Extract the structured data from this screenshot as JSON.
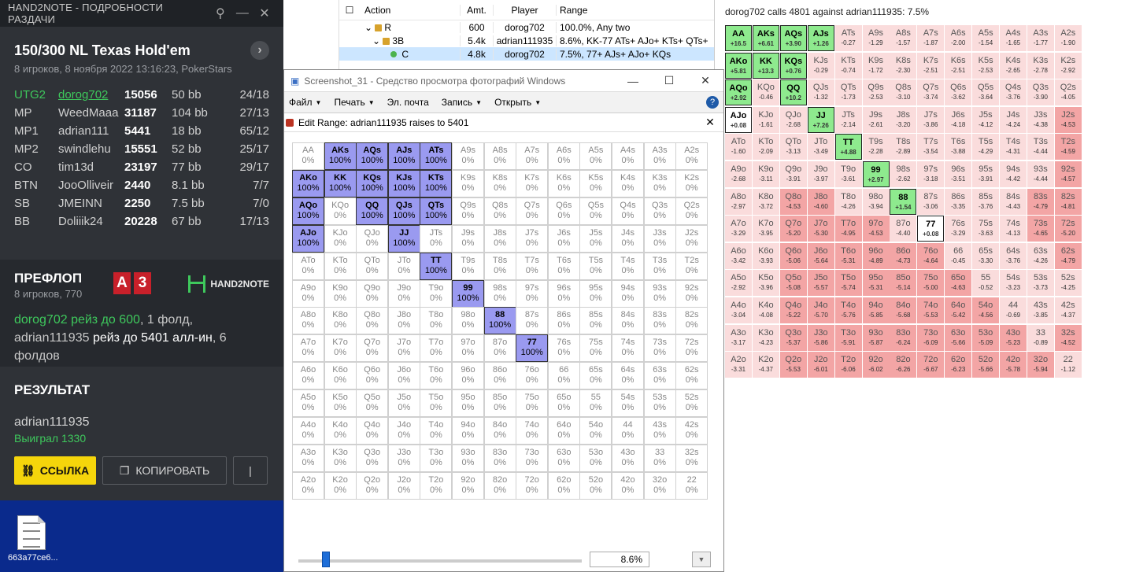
{
  "desktop": {
    "file_label": "663a77ce6..."
  },
  "h2n": {
    "window_title": "HAND2NOTE - ПОДРОБНОСТИ РАЗДАЧИ",
    "game_title": "150/300 NL Texas Hold'em",
    "game_subtitle": "8 игроков, 8 ноября 2022 13:16:23, PokerStars",
    "players": [
      {
        "pos": "UTG2",
        "name": "dorog702",
        "stack": "15056",
        "bb": "50 bb",
        "stat": "24/18"
      },
      {
        "pos": "MP",
        "name": "WeedMaaa",
        "stack": "31187",
        "bb": "104 bb",
        "stat": "27/13"
      },
      {
        "pos": "MP1",
        "name": "adrian111",
        "stack": "5441",
        "bb": "18 bb",
        "stat": "65/12"
      },
      {
        "pos": "MP2",
        "name": "swindlehu",
        "stack": "15551",
        "bb": "52 bb",
        "stat": "25/17"
      },
      {
        "pos": "CO",
        "name": "tim13d",
        "stack": "23197",
        "bb": "77 bb",
        "stat": "29/17"
      },
      {
        "pos": "BTN",
        "name": "JooOlliveir",
        "stack": "2440",
        "bb": "8.1 bb",
        "stat": "7/7"
      },
      {
        "pos": "SB",
        "name": "JMEINN",
        "stack": "2250",
        "bb": "7.5 bb",
        "stat": "7/0"
      },
      {
        "pos": "BB",
        "name": "Doliiik24",
        "stack": "20228",
        "bb": "67 bb",
        "stat": "17/13"
      }
    ],
    "preflop_title": "ПРЕФЛОП",
    "preflop_sub": "8 игроков, 770",
    "cards": [
      "A",
      "3"
    ],
    "logo_text": "HAND2NOTE",
    "action_p1": "dorog702 рейз до 600",
    "action_p2": ", 1 фолд,",
    "action_p3": "adrian111935",
    "action_p4": " рейз до 5401 алл-ин",
    "action_p5": ", 6 фолдов",
    "result_title": "РЕЗУЛЬТАТ",
    "result_name": "adrian111935",
    "result_win": "Выиграл 1330",
    "btn_link": "ССЫЛКА",
    "btn_copy": "КОПИРОВАТЬ"
  },
  "tree": {
    "headers": [
      "Action",
      "Amt.",
      "Player",
      "Range"
    ],
    "rows": [
      {
        "action": "R",
        "amt": "600",
        "player": "dorog702",
        "range": "100.0%, Any two"
      },
      {
        "action": "3B",
        "amt": "5.4k",
        "player": "adrian111935",
        "range": "8.6%, KK-77 ATs+ AJo+ KTs+ QTs+"
      },
      {
        "action": "C",
        "amt": "4.8k",
        "player": "dorog702",
        "range": "7.5%, 77+ AJs+ AJo+ KQs"
      }
    ]
  },
  "viewer": {
    "title": "Screenshot_31 - Средство просмотра фотографий Windows",
    "menu": [
      "Файл",
      "Печать",
      "Эл. почта",
      "Запись",
      "Открыть"
    ],
    "edit_range_title": "Edit Range: adrian111935 raises to 5401",
    "percent": "8.6%",
    "selected": [
      "AKs",
      "AQs",
      "AJs",
      "ATs",
      "AKo",
      "KK",
      "KQs",
      "KJs",
      "KTs",
      "AQo",
      "QQ",
      "QJs",
      "QTs",
      "AJo",
      "JJ",
      "TT",
      "99",
      "88",
      "77"
    ]
  },
  "matrix": {
    "title": "dorog702 calls 4801 against adrian111935: 7.5%",
    "green": [
      "AA",
      "AKs",
      "AQs",
      "AJs",
      "AKo",
      "KK",
      "KQs",
      "AQo",
      "QQ",
      "JJ",
      "TT",
      "99",
      "88"
    ],
    "white": [
      "AJo",
      "77"
    ],
    "colors": {
      "green": "#8eea8e",
      "red_strong": "#f3a5a5",
      "red_light": "#fadcdc"
    },
    "values": [
      [
        "+16.5",
        "+6.61",
        "+3.90",
        "+1.26",
        "-0.27",
        "-1.29",
        "-1.57",
        "-1.87",
        "-2.00",
        "-1.54",
        "-1.65",
        "-1.77",
        "-1.90"
      ],
      [
        "+5.81",
        "+13.3",
        "+0.76",
        "-0.29",
        "-0.74",
        "-1.72",
        "-2.30",
        "-2.51",
        "-2.51",
        "-2.53",
        "-2.65",
        "-2.78",
        "-2.92"
      ],
      [
        "+2.92",
        "-0.46",
        "+10.2",
        "-1.32",
        "-1.73",
        "-2.53",
        "-3.10",
        "-3.74",
        "-3.62",
        "-3.64",
        "-3.76",
        "-3.90",
        "-4.05"
      ],
      [
        "+0.08",
        "-1.61",
        "-2.68",
        "+7.26",
        "-2.14",
        "-2.61",
        "-3.20",
        "-3.86",
        "-4.18",
        "-4.12",
        "-4.24",
        "-4.38",
        "-4.53"
      ],
      [
        "-1.60",
        "-2.09",
        "-3.13",
        "-3.49",
        "+4.88",
        "-2.28",
        "-2.89",
        "-3.54",
        "-3.88",
        "-4.29",
        "-4.31",
        "-4.44",
        "-4.59"
      ],
      [
        "-2.68",
        "-3.11",
        "-3.91",
        "-3.97",
        "-3.61",
        "+2.97",
        "-2.62",
        "-3.18",
        "-3.51",
        "-3.91",
        "-4.42",
        "-4.44",
        "-4.57"
      ],
      [
        "-2.97",
        "-3.72",
        "-4.53",
        "-4.60",
        "-4.26",
        "-3.94",
        "+1.54",
        "-3.06",
        "-3.35",
        "-3.76",
        "-4.43",
        "-4.79",
        "-4.81"
      ],
      [
        "-3.29",
        "-3.95",
        "-5.20",
        "-5.30",
        "-4.95",
        "-4.53",
        "-4.40",
        "+0.08",
        "-3.29",
        "-3.63",
        "-4.13",
        "-4.65",
        "-5.20"
      ],
      [
        "-3.42",
        "-3.93",
        "-5.06",
        "-5.64",
        "-5.31",
        "-4.89",
        "-4.73",
        "-4.64",
        "-0.45",
        "-3.30",
        "-3.76",
        "-4.26",
        "-4.79"
      ],
      [
        "-2.92",
        "-3.96",
        "-5.08",
        "-5.57",
        "-5.74",
        "-5.31",
        "-5.14",
        "-5.00",
        "-4.63",
        "-0.52",
        "-3.23",
        "-3.73",
        "-4.25"
      ],
      [
        "-3.04",
        "-4.08",
        "-5.22",
        "-5.70",
        "-5.76",
        "-5.85",
        "-5.68",
        "-5.53",
        "-5.42",
        "-4.56",
        "-0.69",
        "-3.85",
        "-4.37"
      ],
      [
        "-3.17",
        "-4.23",
        "-5.37",
        "-5.86",
        "-5.91",
        "-5.87",
        "-6.24",
        "-6.09",
        "-5.66",
        "-5.09",
        "-5.23",
        "-0.89",
        "-4.52"
      ],
      [
        "-3.31",
        "-4.37",
        "-5.53",
        "-6.01",
        "-6.06",
        "-6.02",
        "-6.26",
        "-6.67",
        "-6.23",
        "-5.66",
        "-5.78",
        "-5.94",
        "-1.12"
      ]
    ]
  },
  "ranks": [
    "A",
    "K",
    "Q",
    "J",
    "T",
    "9",
    "8",
    "7",
    "6",
    "5",
    "4",
    "3",
    "2"
  ],
  "pct_label": "100%",
  "zero_label": "0%"
}
